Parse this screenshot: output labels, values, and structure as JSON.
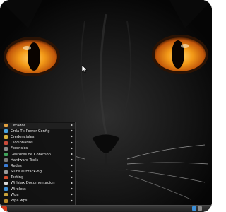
{
  "menu": {
    "items": [
      {
        "label": "Cifrados",
        "icon": "folder-icon",
        "color": "#e0a040"
      },
      {
        "label": "Crda-Tx-Power-Config",
        "icon": "wifi-icon",
        "color": "#4aa3df"
      },
      {
        "label": "Credenciales",
        "icon": "key-icon",
        "color": "#d9b23c"
      },
      {
        "label": "Diccionarios",
        "icon": "book-icon",
        "color": "#c94a3a"
      },
      {
        "label": "Forensics",
        "icon": "magnifier-icon",
        "color": "#8a8a8a"
      },
      {
        "label": "Gestores de Conexion",
        "icon": "network-icon",
        "color": "#3fa35a"
      },
      {
        "label": "Hardware-Tools",
        "icon": "chip-icon",
        "color": "#7a7a7a"
      },
      {
        "label": "Redes",
        "icon": "globe-icon",
        "color": "#3a7bd5"
      },
      {
        "label": "Suite aircrack-ng",
        "icon": "terminal-icon",
        "color": "#9a9a9a"
      },
      {
        "label": "Testing",
        "icon": "gear-icon",
        "color": "#d34a2a"
      },
      {
        "label": "Wifislax Documentacion",
        "icon": "document-icon",
        "color": "#d8d8d8"
      },
      {
        "label": "Wireless",
        "icon": "antenna-icon",
        "color": "#3b8fd8"
      },
      {
        "label": "Wpa",
        "icon": "lock-icon",
        "color": "#c9a23a"
      },
      {
        "label": "Wpa wps",
        "icon": "lock-icon",
        "color": "#b98a2a"
      }
    ]
  },
  "colors": {
    "eye_outer": "#d9740f",
    "eye_inner": "#f6a21a",
    "menu_bg": "#121212",
    "start_button": "#d53a1c"
  }
}
